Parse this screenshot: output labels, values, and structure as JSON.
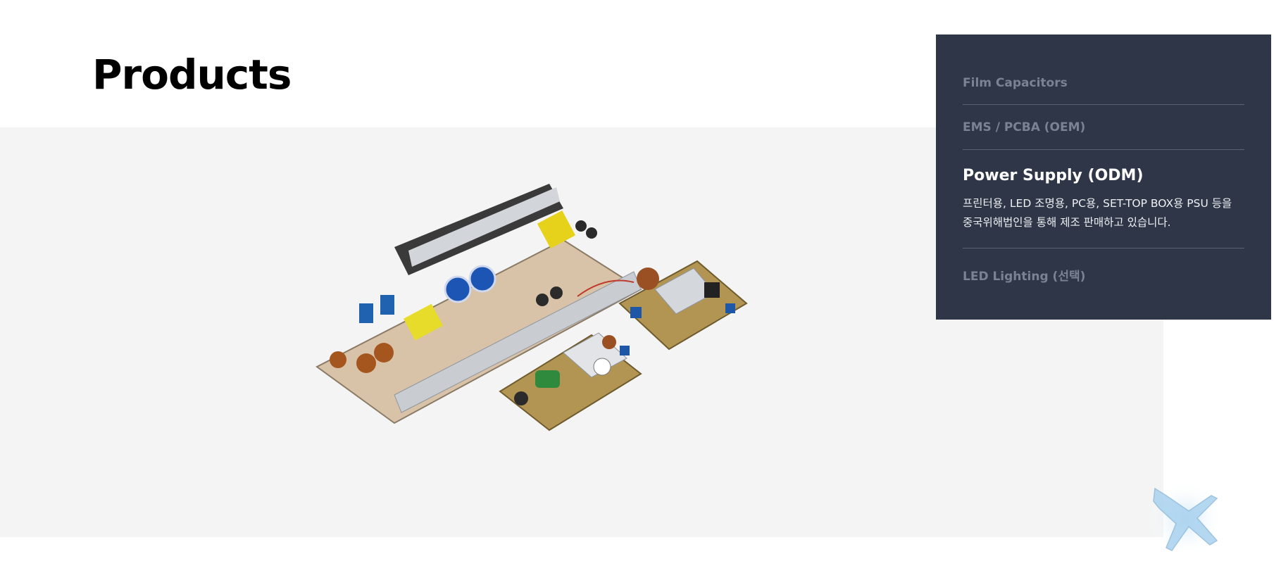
{
  "header": {
    "title": "Products"
  },
  "menu": {
    "items": [
      {
        "label": "Film Capacitors"
      },
      {
        "label": "EMS / PCBA (OEM)"
      },
      {
        "label": "Power Supply (ODM)",
        "description": "프린터용, LED 조명용, PC용, SET-TOP BOX용 PSU 등을 중국위해법인을 통해 제조 판매하고 있습니다."
      },
      {
        "label": "LED Lighting (선택)"
      }
    ]
  },
  "icons": {
    "scroll_top": "airplane-icon",
    "product": "pcb-power-supply-image"
  },
  "colors": {
    "panel": "#2f3647",
    "showcase": "#f4f4f4",
    "active_text": "#ffffff",
    "inactive_text": "#7b8293"
  }
}
